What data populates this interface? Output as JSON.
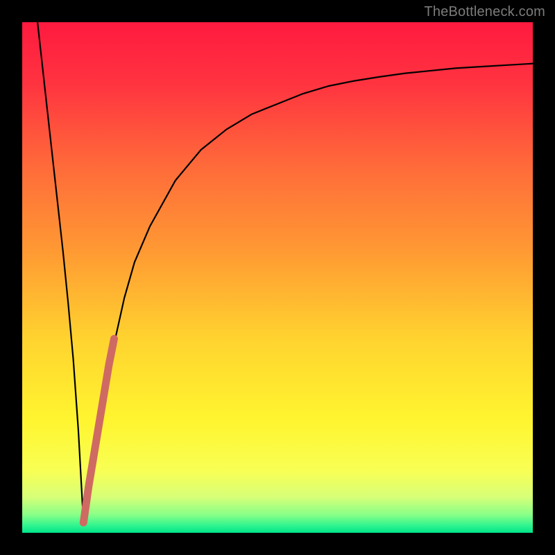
{
  "watermark": "TheBottleneck.com",
  "colors": {
    "frame": "#000000",
    "curve_black": "#000000",
    "curve_red": "#cf6a62",
    "gradient_stops": [
      {
        "offset": 0.0,
        "color": "#ff1a3f"
      },
      {
        "offset": 0.12,
        "color": "#ff3340"
      },
      {
        "offset": 0.28,
        "color": "#ff6a3a"
      },
      {
        "offset": 0.45,
        "color": "#ff9a33"
      },
      {
        "offset": 0.62,
        "color": "#ffd32f"
      },
      {
        "offset": 0.78,
        "color": "#fff52f"
      },
      {
        "offset": 0.88,
        "color": "#f8ff55"
      },
      {
        "offset": 0.93,
        "color": "#d7ff78"
      },
      {
        "offset": 0.965,
        "color": "#88ff88"
      },
      {
        "offset": 0.985,
        "color": "#33f58f"
      },
      {
        "offset": 1.0,
        "color": "#00e58a"
      }
    ]
  },
  "chart_data": {
    "type": "line",
    "title": "",
    "xlabel": "",
    "ylabel": "",
    "xlim": [
      0,
      100
    ],
    "ylim": [
      0,
      100
    ],
    "grid": false,
    "series": [
      {
        "name": "left-branch",
        "x": [
          3,
          4,
          5,
          6,
          7,
          8,
          9,
          10,
          11,
          12
        ],
        "values": [
          100,
          91,
          82,
          73,
          64,
          55,
          45,
          34,
          20,
          2
        ]
      },
      {
        "name": "right-branch",
        "x": [
          12,
          14,
          16,
          18,
          20,
          22,
          25,
          30,
          35,
          40,
          45,
          50,
          55,
          60,
          65,
          70,
          75,
          80,
          85,
          90,
          95,
          100
        ],
        "values": [
          2,
          15,
          27,
          37,
          46,
          53,
          60,
          69,
          75,
          79,
          82,
          84,
          86,
          87.5,
          88.5,
          89.3,
          90,
          90.5,
          91,
          91.3,
          91.6,
          91.9
        ]
      },
      {
        "name": "highlight-segment",
        "x": [
          12,
          13,
          14,
          15,
          16,
          17,
          18
        ],
        "values": [
          2,
          9,
          15,
          21,
          27,
          33,
          38
        ]
      }
    ],
    "notes": "y-values are percentage bottleneck; x is relative component performance. Values are estimated from pixel positions; no numeric axis labels are shown in the source image."
  }
}
